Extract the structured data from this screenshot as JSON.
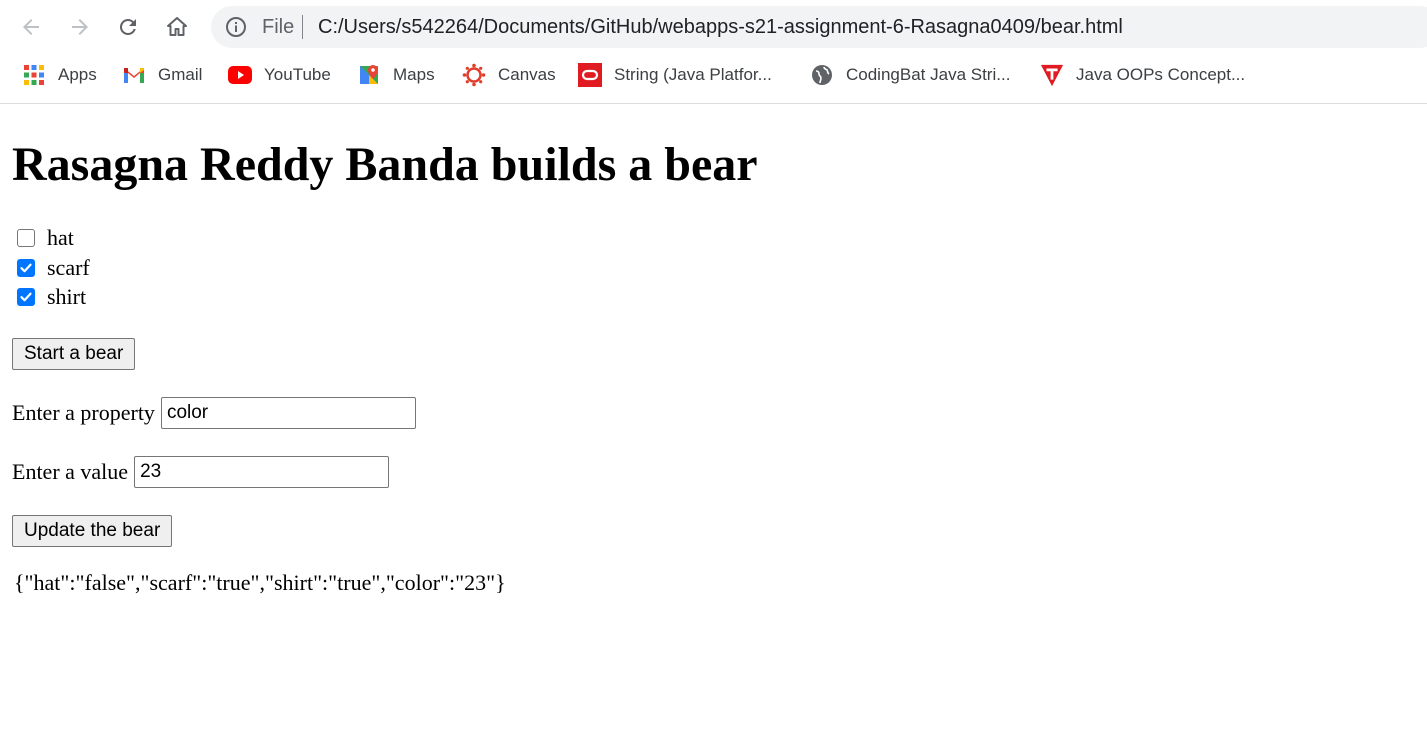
{
  "browser": {
    "omnibox": {
      "scheme_label": "File",
      "url": "C:/Users/s542264/Documents/GitHub/webapps-s21-assignment-6-Rasagna0409/bear.html"
    },
    "bookmarks": [
      {
        "label": "Apps",
        "icon": "apps-grid-icon"
      },
      {
        "label": "Gmail",
        "icon": "gmail-icon"
      },
      {
        "label": "YouTube",
        "icon": "youtube-icon"
      },
      {
        "label": "Maps",
        "icon": "maps-icon"
      },
      {
        "label": "Canvas",
        "icon": "canvas-icon"
      },
      {
        "label": "String (Java Platfor...",
        "icon": "oracle-icon"
      },
      {
        "label": "CodingBat Java Stri...",
        "icon": "globe-icon"
      },
      {
        "label": "Java OOPs Concept...",
        "icon": "javatpoint-icon"
      }
    ]
  },
  "page": {
    "title": "Rasagna Reddy Banda builds a bear",
    "options": [
      {
        "label": "hat",
        "checked": false
      },
      {
        "label": "scarf",
        "checked": true
      },
      {
        "label": "shirt",
        "checked": true
      }
    ],
    "start_button": "Start a bear",
    "property": {
      "label": "Enter a property",
      "value": "color"
    },
    "value": {
      "label": "Enter a value",
      "value": "23"
    },
    "update_button": "Update the bear",
    "output": "{\"hat\":\"false\",\"scarf\":\"true\",\"shirt\":\"true\",\"color\":\"23\"}"
  },
  "colors": {
    "checkbox_accent": "#0075ff",
    "omnibox_bg": "#f1f3f4",
    "button_bg": "#efefef"
  }
}
